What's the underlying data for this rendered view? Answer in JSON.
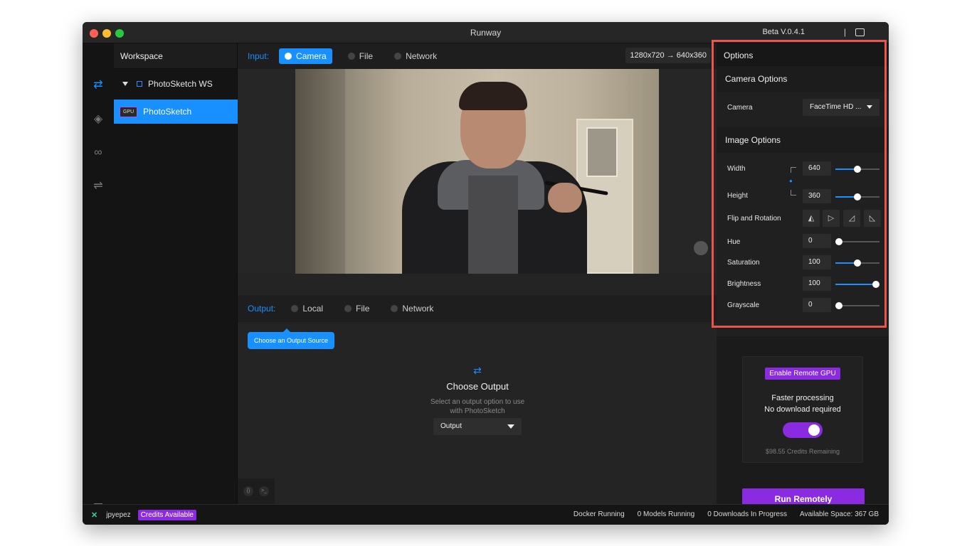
{
  "window": {
    "title": "Runway",
    "beta": "Beta V.0.4.1",
    "beta_sep": "|"
  },
  "workspace": {
    "header": "Workspace",
    "tree_label": "PhotoSketch WS",
    "model_badge": "GPU",
    "model_name": "PhotoSketch"
  },
  "input": {
    "label": "Input:",
    "sources": [
      "Camera",
      "File",
      "Network"
    ],
    "resolution": "1280x720 → 640x360"
  },
  "output": {
    "label": "Output:",
    "sources": [
      "Local",
      "File",
      "Network"
    ],
    "tooltip": "Choose an Output Source",
    "title": "Choose Output",
    "subtitle_line1": "Select an output option to use",
    "subtitle_line2": "with PhotoSketch",
    "select_value": "Output"
  },
  "options": {
    "header": "Options",
    "camera_section": "Camera Options",
    "camera_label": "Camera",
    "camera_value": "FaceTime HD ...",
    "image_section": "Image Options",
    "width_label": "Width",
    "width_value": "640",
    "width_level": 0.5,
    "height_label": "Height",
    "height_value": "360",
    "height_level": 0.5,
    "flip_label": "Flip and Rotation",
    "hue_label": "Hue",
    "hue_value": "0",
    "hue_level": 0.0,
    "saturation_label": "Saturation",
    "saturation_value": "100",
    "saturation_level": 0.5,
    "brightness_label": "Brightness",
    "brightness_value": "100",
    "brightness_level": 1.0,
    "grayscale_label": "Grayscale",
    "grayscale_value": "0",
    "grayscale_level": 0.0
  },
  "remote": {
    "badge": "Enable Remote GPU",
    "line1": "Faster processing",
    "line2": "No download required",
    "credits": "$98.55 Credits Remaining",
    "run_label": "Run Remotely",
    "toggle_on": true
  },
  "status": {
    "user": "jpyepez",
    "credits_badge": "Credits Available",
    "docker": "Docker Running",
    "models": "0 Models Running",
    "downloads": "0 Downloads In Progress",
    "space": "Available Space: 367 GB"
  },
  "colors": {
    "accent": "#1890ff",
    "purple": "#8a2be2",
    "highlight": "#e8574b"
  }
}
